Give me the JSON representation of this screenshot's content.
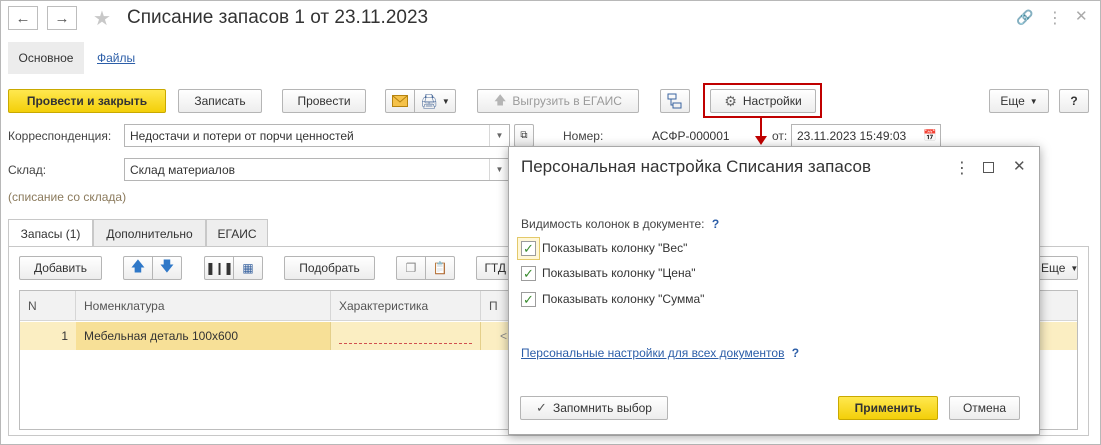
{
  "window": {
    "title": "Списание запасов 1 от 23.11.2023",
    "back_icon": "arrow-left-icon",
    "forward_icon": "arrow-right-icon"
  },
  "nav": {
    "main": "Основное",
    "files": "Файлы"
  },
  "toolbar": {
    "post_close": "Провести и закрыть",
    "save": "Записать",
    "post": "Провести",
    "export_egais": "Выгрузить в ЕГАИС",
    "settings": "Настройки",
    "more": "Еще",
    "help": "?"
  },
  "form": {
    "corr_label": "Корреспонденция:",
    "corr_value": "Недостачи и потери от порчи ценностей",
    "number_label": "Номер:",
    "number_value": "АСФР-000001",
    "date_label": "от:",
    "date_value": "23.11.2023 15:49:03",
    "warehouse_label": "Склад:",
    "warehouse_value": "Склад материалов",
    "note": "(списание со склада)"
  },
  "tabs": [
    "Запасы (1)",
    "Дополнительно",
    "ЕГАИС"
  ],
  "table_toolbar": {
    "add": "Добавить",
    "pick": "Подобрать",
    "gtd": "ГТД",
    "more": "Еще"
  },
  "table": {
    "headers": [
      "N",
      "Номенклатура",
      "Характеристика",
      "П"
    ],
    "rows": [
      {
        "n": "1",
        "item": "Мебельная деталь 100x600",
        "char": "",
        "extra": "<"
      }
    ]
  },
  "dialog": {
    "title": "Персональная настройка Списания запасов",
    "section_label": "Видимость колонок в документе:",
    "options": [
      {
        "label": "Показывать колонку \"Вес\"",
        "checked": true
      },
      {
        "label": "Показывать колонку \"Цена\"",
        "checked": true
      },
      {
        "label": "Показывать колонку \"Сумма\"",
        "checked": true
      }
    ],
    "personal_link": "Персональные настройки для всех документов",
    "remember": "Запомнить выбор",
    "apply": "Применить",
    "cancel": "Отмена",
    "help": "?"
  },
  "colors": {
    "accent_yellow": "#f6d31a",
    "highlight_red": "#c00000",
    "link": "#2c5ea8",
    "row_selected": "#fbeec2"
  }
}
